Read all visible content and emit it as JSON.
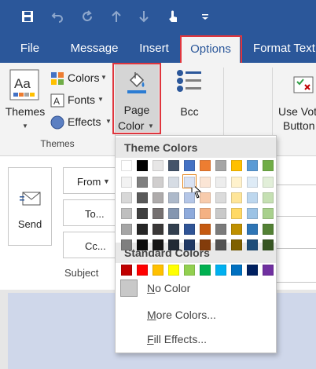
{
  "quick_access": [
    {
      "name": "save-icon",
      "glyph": "💾"
    },
    {
      "name": "undo-icon",
      "glyph": "↶"
    },
    {
      "name": "redo-icon",
      "glyph": "↻"
    },
    {
      "name": "up-arrow-icon",
      "glyph": "↑"
    },
    {
      "name": "down-arrow-icon",
      "glyph": "↓"
    },
    {
      "name": "touch-mode-icon",
      "glyph": "☝"
    },
    {
      "name": "customize-qat-icon",
      "glyph": "⌄"
    }
  ],
  "tabs": [
    {
      "label": "File"
    },
    {
      "label": "Message"
    },
    {
      "label": "Insert"
    },
    {
      "label": "Options"
    },
    {
      "label": "Format Text"
    }
  ],
  "ribbon": {
    "themes_label": "Themes",
    "colors_label": "Colors",
    "fonts_label": "Fonts",
    "effects_label": "Effects",
    "group_themes": "Themes",
    "page_color_line1": "Page",
    "page_color_line2": "Color",
    "bcc_label": "Bcc",
    "voting_line1": "Use Vot",
    "voting_line2": "Button"
  },
  "form": {
    "send_label": "Send",
    "from_label": "From",
    "to_label": "To...",
    "cc_label": "Cc...",
    "subject_label": "Subject"
  },
  "dropdown": {
    "theme_header": "Theme Colors",
    "standard_header": "Standard Colors",
    "no_color": "No Color",
    "more_colors": "More Colors...",
    "fill_effects": "Fill Effects...",
    "theme_top_row": [
      "#ffffff",
      "#000000",
      "#e7e6e6",
      "#44546a",
      "#4472c4",
      "#ed7d31",
      "#a5a5a5",
      "#ffc000",
      "#5b9bd5",
      "#70ad47"
    ],
    "theme_shades": [
      [
        "#f2f2f2",
        "#7f7f7f",
        "#d0cece",
        "#d6dce4",
        "#d9e2f3",
        "#fbe5d5",
        "#ededed",
        "#fff2cc",
        "#deebf6",
        "#e2efd9"
      ],
      [
        "#d8d8d8",
        "#595959",
        "#aeabab",
        "#adb9ca",
        "#b4c6e7",
        "#f7cbac",
        "#dbdbdb",
        "#fee599",
        "#bdd7ee",
        "#c5e0b3"
      ],
      [
        "#bfbfbf",
        "#3f3f3f",
        "#757070",
        "#8496b0",
        "#8eaadb",
        "#f4b183",
        "#c9c9c9",
        "#ffd965",
        "#9cc3e5",
        "#a8d08d"
      ],
      [
        "#a5a5a5",
        "#262626",
        "#3a3838",
        "#323f4f",
        "#2f5496",
        "#c55a11",
        "#7b7b7b",
        "#bf9000",
        "#2e75b5",
        "#538135"
      ],
      [
        "#7f7f7f",
        "#0c0c0c",
        "#171616",
        "#222a35",
        "#1f3864",
        "#833c0b",
        "#525252",
        "#7f6000",
        "#1f4e79",
        "#375623"
      ]
    ],
    "standard_row": [
      "#c00000",
      "#ff0000",
      "#ffc000",
      "#ffff00",
      "#92d050",
      "#00b050",
      "#00b0f0",
      "#0070c0",
      "#002060",
      "#7030a0"
    ]
  },
  "colors": {
    "title_bar": "#2b579a",
    "ribbon_bg": "#f3f3f3",
    "highlight_box": "#e0353d",
    "mail_body": "#cfd7ea"
  }
}
